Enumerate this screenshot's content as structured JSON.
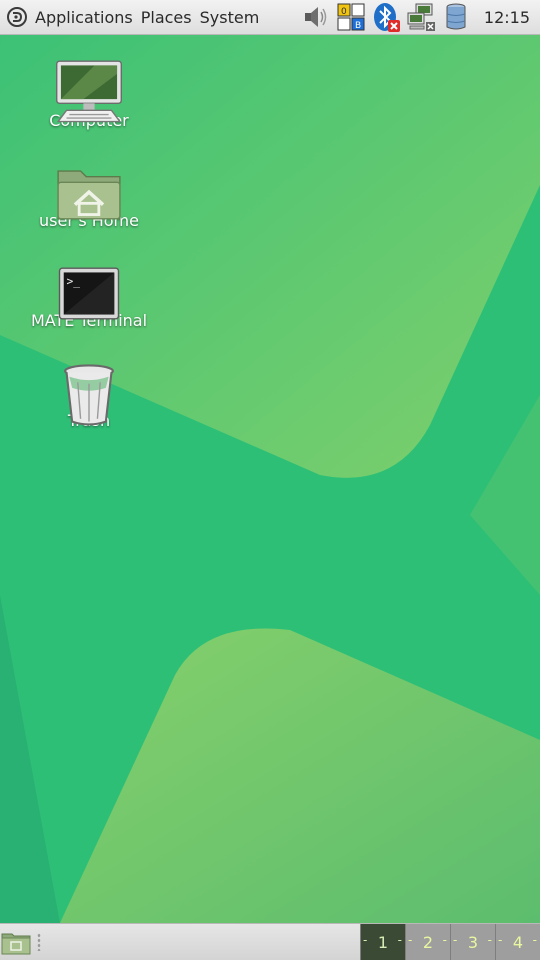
{
  "top_panel": {
    "menus": [
      "Applications",
      "Places",
      "System"
    ],
    "clock": "12:15",
    "tray_icons": [
      "volume-icon",
      "keyboard-layout-icon",
      "bluetooth-icon",
      "network-icon",
      "storage-icon"
    ],
    "keyboard_indicator": {
      "top": "0",
      "bottom": "B"
    }
  },
  "desktop_icons": [
    {
      "label": "Computer",
      "icon": "computer-icon"
    },
    {
      "label": "user's Home",
      "icon": "home-folder-icon"
    },
    {
      "label": "MATE Terminal",
      "icon": "terminal-icon"
    },
    {
      "label": "Trash",
      "icon": "trash-icon"
    }
  ],
  "bottom_panel": {
    "workspaces": [
      "1",
      "2",
      "3",
      "4"
    ],
    "active_workspace": "1"
  },
  "colors": {
    "wallpaper_base": "#2ebf76",
    "wallpaper_light": "#8fd36a",
    "panel": "#e4e4e4",
    "workspace_active": "#3a4a35",
    "workspace_inactive": "#9e9e9e"
  }
}
